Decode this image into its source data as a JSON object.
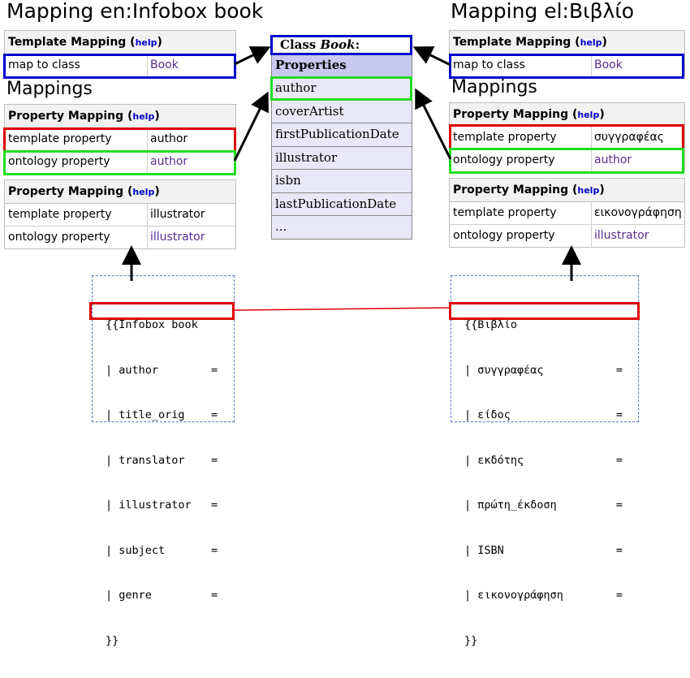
{
  "left": {
    "title_prefix": "Mapping en:",
    "title_name": "Infobox book",
    "template_mapping": {
      "header": "Template Mapping",
      "help": "help",
      "row_label": "map to class",
      "row_value": "Book"
    },
    "mappings_heading": "Mappings",
    "property_mappings": [
      {
        "header": "Property Mapping",
        "help": "help",
        "rows": [
          {
            "label": "template property",
            "value": "author",
            "is_link": false
          },
          {
            "label": "ontology property",
            "value": "author",
            "is_link": true
          }
        ]
      },
      {
        "header": "Property Mapping",
        "help": "help",
        "rows": [
          {
            "label": "template property",
            "value": "illustrator",
            "is_link": false
          },
          {
            "label": "ontology property",
            "value": "illustrator",
            "is_link": true
          }
        ]
      }
    ],
    "infobox_lines": [
      "{{Infobox book",
      "| author        =",
      "| title_orig    =",
      "| translator    =",
      "| illustrator   =",
      "| subject       =",
      "| genre         =",
      "}}"
    ]
  },
  "right": {
    "title_prefix": "Mapping el:",
    "title_name": "Βιβλίο",
    "template_mapping": {
      "header": "Template Mapping",
      "help": "help",
      "row_label": "map to class",
      "row_value": "Book"
    },
    "mappings_heading": "Mappings",
    "property_mappings": [
      {
        "header": "Property Mapping",
        "help": "help",
        "rows": [
          {
            "label": "template property",
            "value": "συγγραφέας",
            "is_link": false
          },
          {
            "label": "ontology property",
            "value": "author",
            "is_link": true
          }
        ]
      },
      {
        "header": "Property Mapping",
        "help": "help",
        "rows": [
          {
            "label": "template property",
            "value": "εικονογράφηση",
            "is_link": false
          },
          {
            "label": "ontology property",
            "value": "illustrator",
            "is_link": true
          }
        ]
      }
    ],
    "infobox_lines": [
      "{{Βιβλίο",
      "| συγγραφέας           =",
      "| είδος                =",
      "| εκδότης              =",
      "| πρώτη_έκδοση         =",
      "| ISBN                 =",
      "| εικονογράφηση        =",
      "}}"
    ]
  },
  "class_box": {
    "prefix": "Class ",
    "name": "Book",
    "suffix": ":",
    "properties_header": "Properties",
    "properties": [
      "author",
      "coverArtist",
      "firstPublicationDate",
      "illustrator",
      "isbn",
      "lastPublicationDate",
      "..."
    ]
  },
  "colors": {
    "blue": "#0000cc",
    "red": "#dd0000",
    "green": "#22dd22",
    "link": "#5a2d91",
    "help": "#0000cc"
  }
}
